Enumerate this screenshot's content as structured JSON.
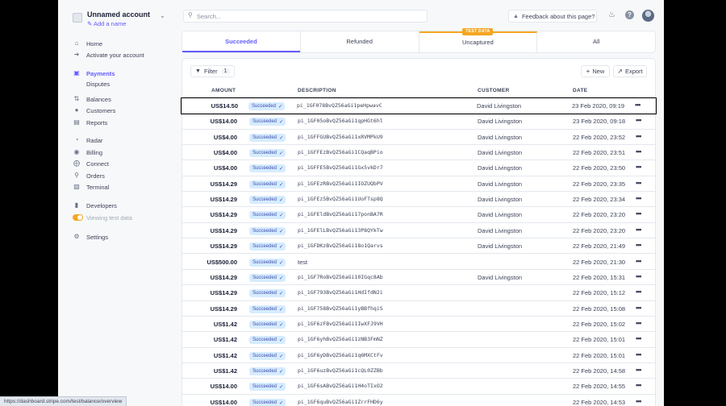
{
  "account": {
    "name": "Unnamed account",
    "add_name": "Add a name"
  },
  "search": {
    "placeholder": "Search...",
    "value": ""
  },
  "header": {
    "feedback": "Feedback about this page?"
  },
  "nav": {
    "home": "Home",
    "activate": "Activate your account",
    "payments": "Payments",
    "disputes": "Disputes",
    "balances": "Balances",
    "customers": "Customers",
    "reports": "Reports",
    "radar": "Radar",
    "billing": "Billing",
    "connect": "Connect",
    "orders": "Orders",
    "terminal": "Terminal",
    "developers": "Developers",
    "test_data": "Viewing test data",
    "settings": "Settings"
  },
  "tabs": [
    {
      "label": "Succeeded"
    },
    {
      "label": "Refunded",
      "badge": "TEST DATA"
    },
    {
      "label": "Uncaptured"
    },
    {
      "label": "All"
    }
  ],
  "toolbar": {
    "filter": "Filter",
    "filter_count": "1",
    "new": "New",
    "export": "Export"
  },
  "table": {
    "columns": {
      "amount": "AMOUNT",
      "description": "DESCRIPTION",
      "customer": "CUSTOMER",
      "date": "DATE"
    },
    "rows": [
      {
        "amount": "US$14.50",
        "status": "Succeeded",
        "description": "pi_1GF078BvQZ56aGi1peHpwavC",
        "customer": "David Livingston",
        "date": "23 Feb 2020, 09:19"
      },
      {
        "amount": "US$14.00",
        "status": "Succeeded",
        "description": "pi_1GF05oBvQZ56aGi1qpHGt6hl",
        "customer": "David Livingston",
        "date": "23 Feb 2020, 09:18"
      },
      {
        "amount": "US$4.00",
        "status": "Succeeded",
        "description": "pi_1GFFGUBvQZ56aGi1xRVMPkU9",
        "customer": "David Livingston",
        "date": "22 Feb 2020, 23:52"
      },
      {
        "amount": "US$4.00",
        "status": "Succeeded",
        "description": "pi_1GFFEzBvQZ56aGi1CQaqBPio",
        "customer": "David Livingston",
        "date": "22 Feb 2020, 23:51"
      },
      {
        "amount": "US$4.00",
        "status": "Succeeded",
        "description": "pi_1GFFE5BvQZ56aGi1Gx5vkDr7",
        "customer": "David Livingston",
        "date": "22 Feb 2020, 23:50"
      },
      {
        "amount": "US$14.29",
        "status": "Succeeded",
        "description": "pi_1GFEzRBvQZ56aGi1IOZUQbPV",
        "customer": "David Livingston",
        "date": "22 Feb 2020, 23:35"
      },
      {
        "amount": "US$14.29",
        "status": "Succeeded",
        "description": "pi_1GFEz5BvQZ56aGi1UoFTsp8Q",
        "customer": "David Livingston",
        "date": "22 Feb 2020, 23:34"
      },
      {
        "amount": "US$14.29",
        "status": "Succeeded",
        "description": "pi_1GFEldBvQZ56aGi17ponBA7R",
        "customer": "David Livingston",
        "date": "22 Feb 2020, 23:20"
      },
      {
        "amount": "US$14.29",
        "status": "Succeeded",
        "description": "pi_1GFElLBvQZ56aGi13P8QYkTw",
        "customer": "David Livingston",
        "date": "22 Feb 2020, 23:20"
      },
      {
        "amount": "US$14.29",
        "status": "Succeeded",
        "description": "pi_1GFDKzBvQZ56aGi18o1Qarvs",
        "customer": "David Livingston",
        "date": "22 Feb 2020, 21:49"
      },
      {
        "amount": "US$500.00",
        "status": "Succeeded",
        "description": "test",
        "customer": "",
        "date": "22 Feb 2020, 21:30"
      },
      {
        "amount": "US$14.29",
        "status": "Succeeded",
        "description": "pi_1GF7RoBvQZ56aGi10IGqc8Ab",
        "customer": "David Livingston",
        "date": "22 Feb 2020, 15:31"
      },
      {
        "amount": "US$14.29",
        "status": "Succeeded",
        "description": "pi_1GF793BvQZ56aGi1HdIfdN2i",
        "customer": "",
        "date": "22 Feb 2020, 15:12"
      },
      {
        "amount": "US$14.29",
        "status": "Succeeded",
        "description": "pi_1GF758BvQZ56aGi1yBBfhqiS",
        "customer": "",
        "date": "22 Feb 2020, 15:08"
      },
      {
        "amount": "US$1.42",
        "status": "Succeeded",
        "description": "pi_1GF6zFBvQZ56aGi1IwXFJ9VH",
        "customer": "",
        "date": "22 Feb 2020, 15:02"
      },
      {
        "amount": "US$1.42",
        "status": "Succeeded",
        "description": "pi_1GF6yhBvQZ56aGi1zNB3FmNZ",
        "customer": "",
        "date": "22 Feb 2020, 15:01"
      },
      {
        "amount": "US$1.42",
        "status": "Succeeded",
        "description": "pi_1GF6yDBvQZ56aGi1q6MXCtFv",
        "customer": "",
        "date": "22 Feb 2020, 15:01"
      },
      {
        "amount": "US$1.42",
        "status": "Succeeded",
        "description": "pi_1GF6uzBvQZ56aGi1cQL0ZZBb",
        "customer": "",
        "date": "22 Feb 2020, 14:58"
      },
      {
        "amount": "US$14.00",
        "status": "Succeeded",
        "description": "pi_1GF6sABvQZ56aGi1H4oTIxO2",
        "customer": "",
        "date": "22 Feb 2020, 14:55"
      },
      {
        "amount": "US$14.00",
        "status": "Succeeded",
        "description": "pi_1GF6quBvQZ56aGi1ZrrFHD6y",
        "customer": "",
        "date": "22 Feb 2020, 14:53"
      }
    ]
  },
  "statusbar": {
    "url": "https://dashboard.stripe.com/test/balance/overview"
  },
  "colors": {
    "accent": "#635bff",
    "test_badge": "#f5a623",
    "status_bg": "#d6ecff",
    "status_text": "#3d4eac"
  }
}
